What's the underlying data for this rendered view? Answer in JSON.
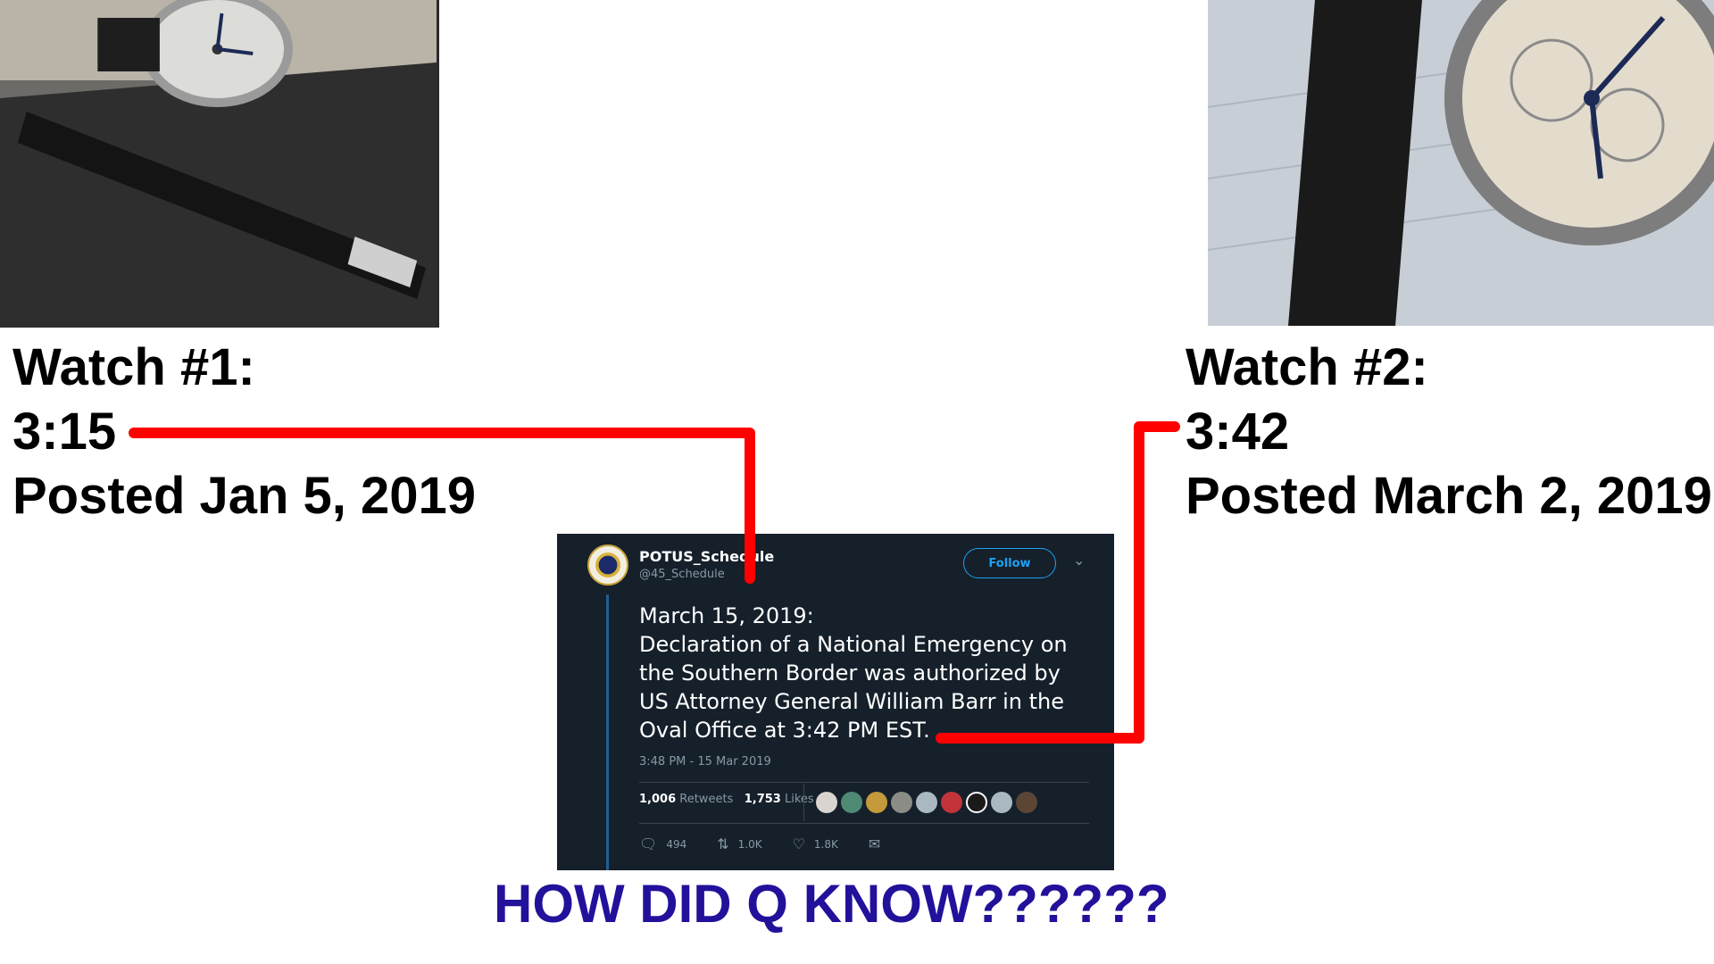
{
  "watch1": {
    "title": "Watch #1:",
    "time": "3:15",
    "posted": "Posted Jan 5, 2019"
  },
  "watch2": {
    "title": "Watch #2:",
    "time": "3:42",
    "posted": "Posted March 2, 2019"
  },
  "tweet": {
    "name": "POTUS_Schedule",
    "handle": "@45_Schedule",
    "follow_label": "Follow",
    "body_lines": [
      "March 15, 2019:",
      "Declaration of a National Emergency on",
      "the Southern Border was authorized by",
      "US Attorney General William Barr in the",
      "Oval Office at 3:42 PM EST."
    ],
    "timestamp": "3:48 PM - 15 Mar 2019",
    "retweets_count": "1,006",
    "retweets_label": "Retweets",
    "likes_count": "1,753",
    "likes_label": "Likes",
    "reply_count": "494",
    "retweet_action_count": "1.0K",
    "like_action_count": "1.8K"
  },
  "headline": "HOW DID Q KNOW??????",
  "colors": {
    "connector": "#ff0000",
    "headline": "#22119a",
    "tweet_bg": "#15202b",
    "accent": "#1da1f2"
  },
  "icons": [
    "reply-icon",
    "retweet-icon",
    "heart-icon",
    "mail-icon",
    "chevron-down-icon"
  ]
}
